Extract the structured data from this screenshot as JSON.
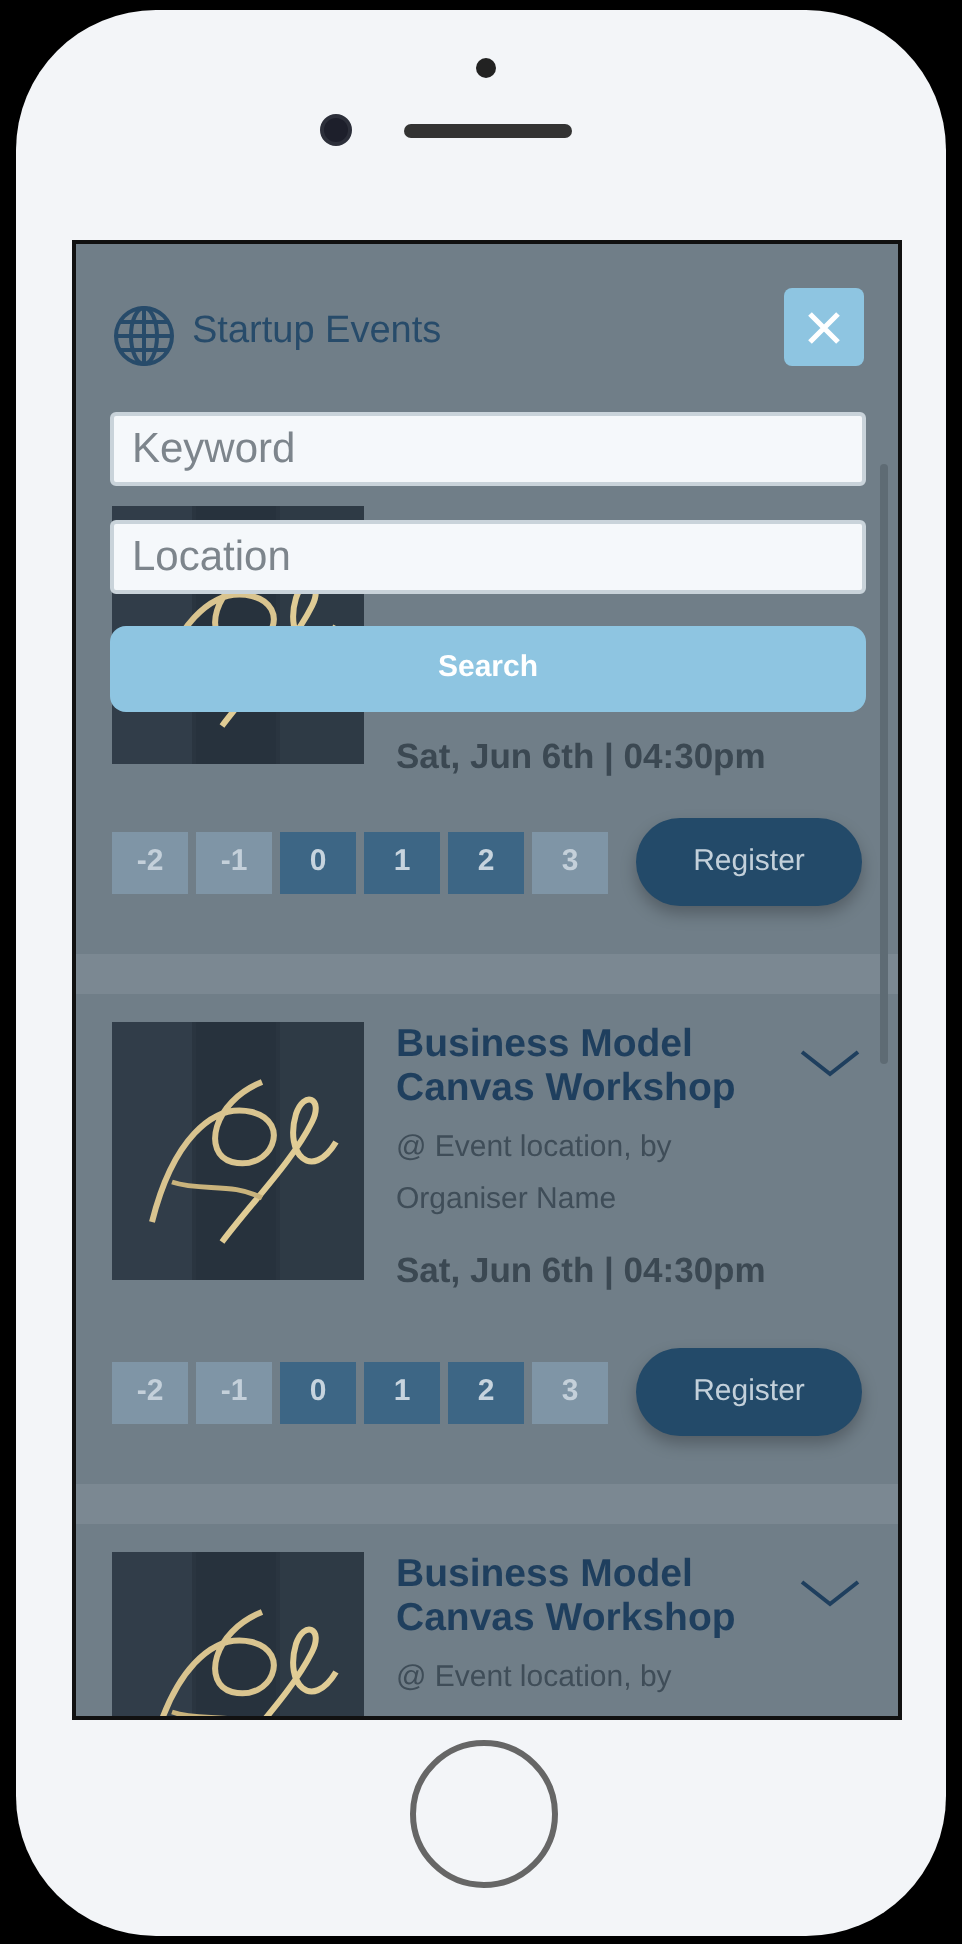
{
  "header": {
    "title": "Startup Events"
  },
  "search": {
    "keyword_placeholder": "Keyword",
    "location_placeholder": "Location",
    "button": "Search"
  },
  "events": [
    {
      "date": "Sat, Jun 6th | 04:30pm",
      "scale": [
        {
          "label": "-2",
          "selected": false
        },
        {
          "label": "-1",
          "selected": false
        },
        {
          "label": "0",
          "selected": true
        },
        {
          "label": "1",
          "selected": true
        },
        {
          "label": "2",
          "selected": true
        },
        {
          "label": "3",
          "selected": false
        }
      ],
      "button": "Register"
    },
    {
      "title": "Business Model Canvas Workshop",
      "expanded": false,
      "location": "@ Event location, by Organiser Name",
      "date": "Sat, Jun 6th | 04:30pm",
      "scale": [
        {
          "label": "-2",
          "selected": false
        },
        {
          "label": "-1",
          "selected": false
        },
        {
          "label": "0",
          "selected": true
        },
        {
          "label": "1",
          "selected": true
        },
        {
          "label": "2",
          "selected": true
        },
        {
          "label": "3",
          "selected": false
        }
      ],
      "button": "Register"
    },
    {
      "title": "Business Model Canvas Workshop",
      "expanded": false,
      "location": "@ Event location, by"
    }
  ]
}
